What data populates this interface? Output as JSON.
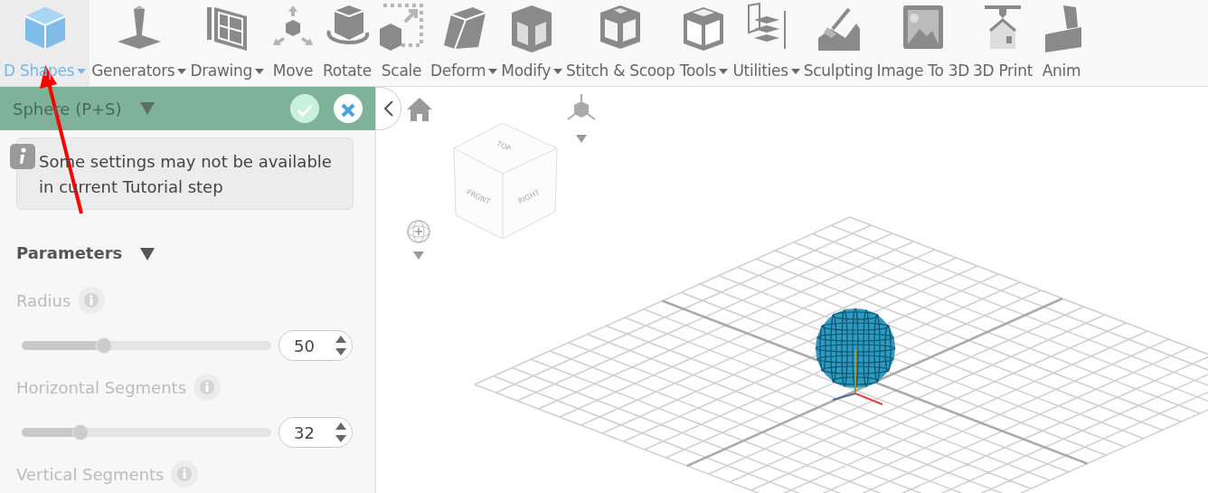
{
  "toolbar": {
    "items": [
      {
        "label": "D Shapes",
        "has_menu": true,
        "selected": true
      },
      {
        "label": "Generators",
        "has_menu": true,
        "selected": false
      },
      {
        "label": "Drawing",
        "has_menu": true,
        "selected": false
      },
      {
        "label": "Move",
        "has_menu": false,
        "selected": false
      },
      {
        "label": "Rotate",
        "has_menu": false,
        "selected": false
      },
      {
        "label": "Scale",
        "has_menu": false,
        "selected": false
      },
      {
        "label": "Deform",
        "has_menu": true,
        "selected": false
      },
      {
        "label": "Modify",
        "has_menu": true,
        "selected": false
      },
      {
        "label": "Stitch & Scoop",
        "has_menu": false,
        "selected": false
      },
      {
        "label": "Tools",
        "has_menu": true,
        "selected": false
      },
      {
        "label": "Utilities",
        "has_menu": true,
        "selected": false
      },
      {
        "label": "Sculpting",
        "has_menu": false,
        "selected": false
      },
      {
        "label": "Image To 3D",
        "has_menu": false,
        "selected": false
      },
      {
        "label": "3D Print",
        "has_menu": false,
        "selected": false
      },
      {
        "label": "Anim",
        "has_menu": false,
        "selected": false
      }
    ]
  },
  "panel": {
    "title": "Sphere (P+S)",
    "notice": "Some settings may not be available in current Tutorial step",
    "section": "Parameters",
    "params": [
      {
        "label": "Radius",
        "level": 0.33,
        "value": "50"
      },
      {
        "label": "Horizontal Segments",
        "level": 0.235,
        "value": "32"
      },
      {
        "label": "Vertical Segments"
      }
    ]
  },
  "viewport": {
    "view_cube": {
      "top": "TOP",
      "front": "FRONT",
      "right": "RIGHT"
    }
  }
}
